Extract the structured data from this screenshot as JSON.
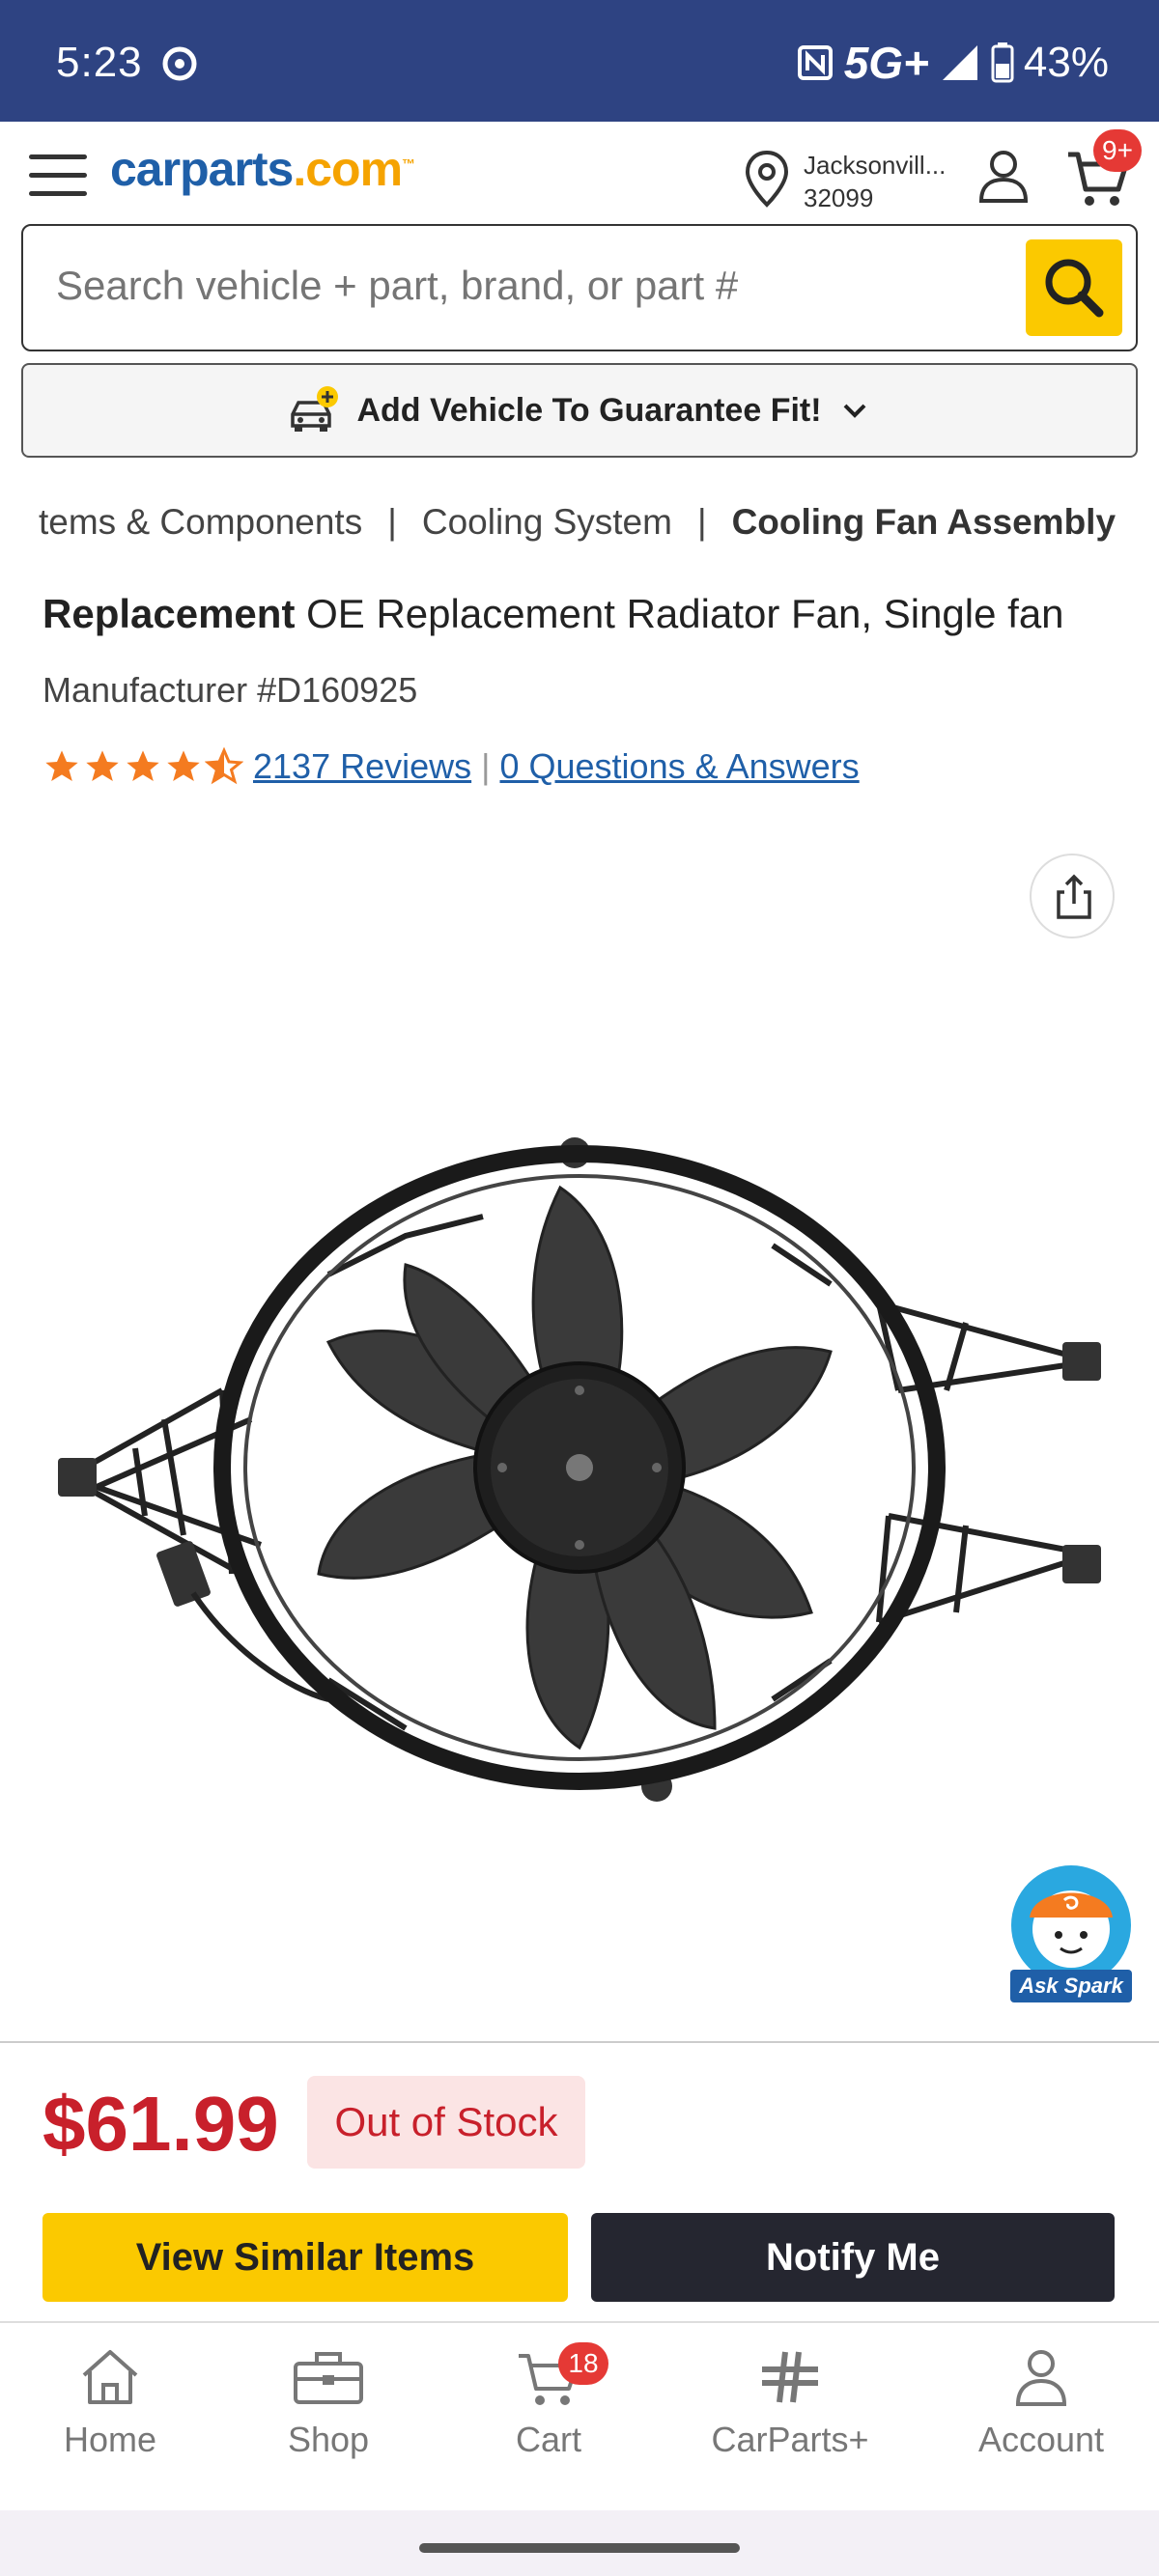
{
  "status_bar": {
    "time": "5:23",
    "network": "5G+",
    "battery": "43%"
  },
  "header": {
    "logo_main": "carparts",
    "logo_suffix": ".com",
    "logo_tm": "™",
    "location_city": "Jacksonvill...",
    "location_zip": "32099",
    "cart_badge": "9+"
  },
  "search": {
    "placeholder": "Search vehicle + part, brand, or part #"
  },
  "vehicle_bar": {
    "label": "Add Vehicle To Guarantee Fit!"
  },
  "breadcrumb": {
    "items": [
      "tems & Components",
      "Cooling System",
      "Cooling Fan Assembly"
    ],
    "separator": "|"
  },
  "product": {
    "brand": "Replacement",
    "name": "OE Replacement Radiator Fan, Single fan",
    "manufacturer": "Manufacturer #D160925",
    "rating": 4.5,
    "reviews_link": "2137 Reviews",
    "divider": "|",
    "qa_link": "0 Questions & Answers",
    "image_alt": "cooling fan assembly"
  },
  "assistant": {
    "label": "Ask Spark"
  },
  "purchase": {
    "price": "$61.99",
    "stock_status": "Out of Stock",
    "similar_button": "View Similar Items",
    "notify_button": "Notify Me"
  },
  "bottom_nav": {
    "home": "Home",
    "shop": "Shop",
    "cart": "Cart",
    "cart_badge": "18",
    "carparts_plus": "CarParts+",
    "account": "Account"
  },
  "colors": {
    "status_bar": "#2e4382",
    "brand_blue": "#1f5fa8",
    "accent_yellow": "#fbc900",
    "price_red": "#c8202b",
    "star_orange": "#f47b20"
  }
}
